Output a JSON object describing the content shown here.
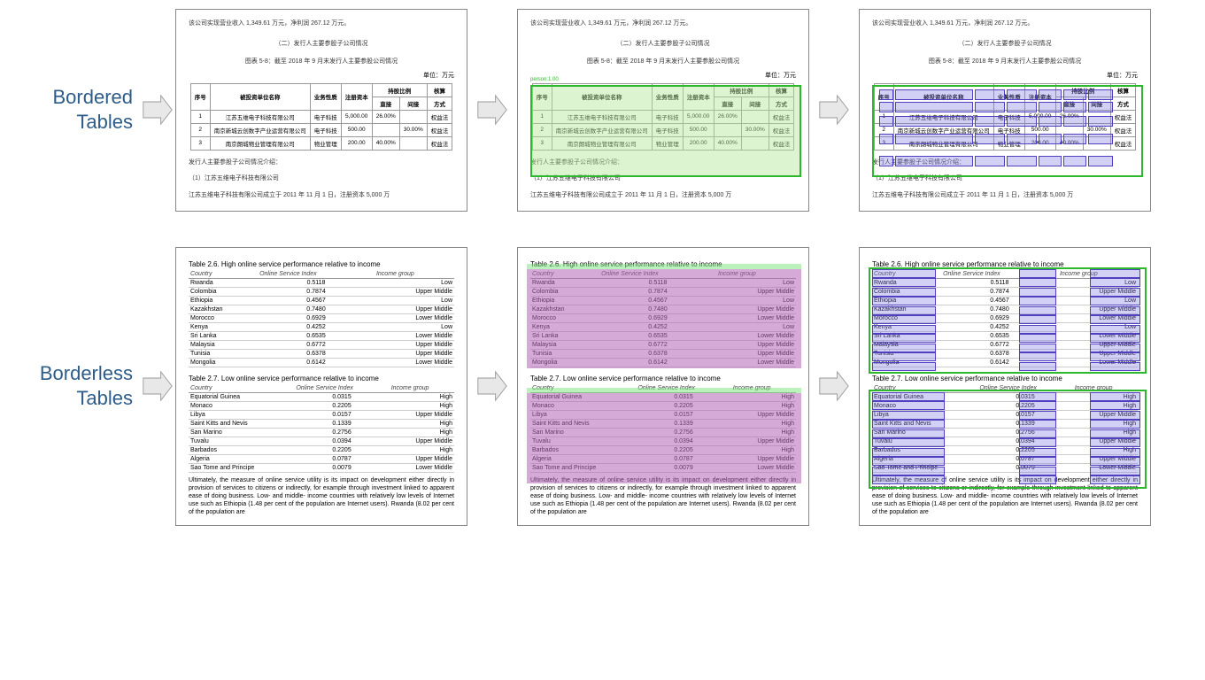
{
  "labels": {
    "bordered": "Bordered Tables",
    "borderless": "Borderless Tables"
  },
  "cn_doc": {
    "line1": "该公司实现营业收入 1,349.61 万元，净利润 267.12 万元。",
    "line2": "（二）发行人主要参股子公司情况",
    "line3": "图表 5-8：截至 2018 年 9 月末发行人主要参股公司情况",
    "unit": "单位：万元",
    "headers": {
      "h1": "序号",
      "h2": "被投资单位名称",
      "h3": "业务性质",
      "h4": "注册资本",
      "h5": "持股比例",
      "h5a": "直接",
      "h5b": "间接",
      "h6": "核算",
      "h6a": "方式"
    },
    "rows": [
      {
        "n": "1",
        "name": "江苏五维电子科技有限公司",
        "biz": "电子科技",
        "cap": "5,000.00",
        "direct": "26.00%",
        "indirect": "",
        "method": "权益法"
      },
      {
        "n": "2",
        "name": "南京新城云创数字产业运营有限公司",
        "biz": "电子科技",
        "cap": "500.00",
        "direct": "",
        "indirect": "30.00%",
        "method": "权益法"
      },
      {
        "n": "3",
        "name": "南京朗城物业管理有限公司",
        "biz": "物业管理",
        "cap": "200.00",
        "direct": "40.00%",
        "indirect": "",
        "method": "权益法"
      }
    ],
    "after1": "发行人主要参股子公司情况介绍：",
    "after2": "（1）江苏五维电子科技有限公司",
    "after3": "江苏五维电子科技有限公司成立于 2011 年 11 月 1 日，注册资本 5,000 万",
    "detlabel": "person:1.00"
  },
  "en_doc": {
    "t1": "Table 2.6.   High online service performance relative to income",
    "t2": "Table 2.7.   Low online service performance relative to income",
    "hdr": {
      "c1": "Country",
      "c2": "Online Service Index",
      "c3": "Income group"
    },
    "tab1": [
      {
        "c": "Rwanda",
        "v": "0.5118",
        "g": "Low"
      },
      {
        "c": "Colombia",
        "v": "0.7874",
        "g": "Upper Middle"
      },
      {
        "c": "Ethiopia",
        "v": "0.4567",
        "g": "Low"
      },
      {
        "c": "Kazakhstan",
        "v": "0.7480",
        "g": "Upper Middle"
      },
      {
        "c": "Morocco",
        "v": "0.6929",
        "g": "Lower Middle"
      },
      {
        "c": "Kenya",
        "v": "0.4252",
        "g": "Low"
      },
      {
        "c": "Sri Lanka",
        "v": "0.6535",
        "g": "Lower Middle"
      },
      {
        "c": "Malaysia",
        "v": "0.6772",
        "g": "Upper Middle"
      },
      {
        "c": "Tunisia",
        "v": "0.6378",
        "g": "Upper Middle"
      },
      {
        "c": "Mongolia",
        "v": "0.6142",
        "g": "Lower Middle"
      }
    ],
    "tab2": [
      {
        "c": "Equatorial Guinea",
        "v": "0.0315",
        "g": "High"
      },
      {
        "c": "Monaco",
        "v": "0.2205",
        "g": "High"
      },
      {
        "c": "Libya",
        "v": "0.0157",
        "g": "Upper Middle"
      },
      {
        "c": "Saint Kitts and Nevis",
        "v": "0.1339",
        "g": "High"
      },
      {
        "c": "San Marino",
        "v": "0.2756",
        "g": "High"
      },
      {
        "c": "Tuvalu",
        "v": "0.0394",
        "g": "Upper Middle"
      },
      {
        "c": "Barbados",
        "v": "0.2205",
        "g": "High"
      },
      {
        "c": "Algeria",
        "v": "0.0787",
        "g": "Upper Middle"
      },
      {
        "c": "Sao Tome and Principe",
        "v": "0.0079",
        "g": "Lower Middle"
      }
    ],
    "para": "Ultimately, the measure of online service utility is its impact on development either directly in provision of services to citizens or indirectly, for example through investment linked to apparent ease of doing business. Low- and middle- income countries with relatively low levels of Internet use such as Ethiopia (1.48 per cent of the population are Internet users). Rwanda (8.02 per cent of the population are"
  }
}
